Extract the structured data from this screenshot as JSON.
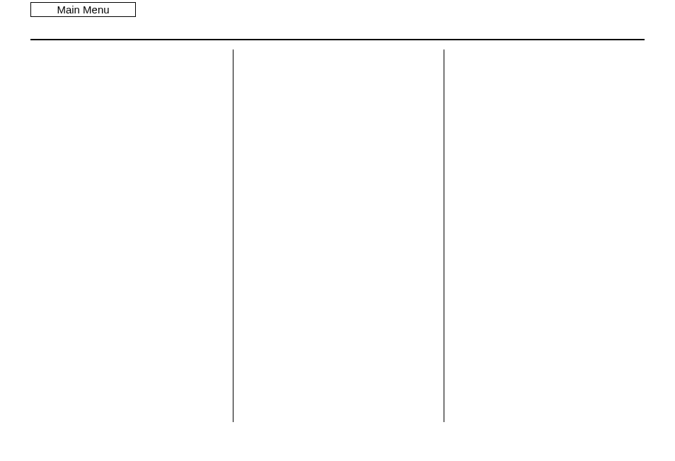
{
  "header": {
    "main_menu_label": "Main Menu"
  }
}
